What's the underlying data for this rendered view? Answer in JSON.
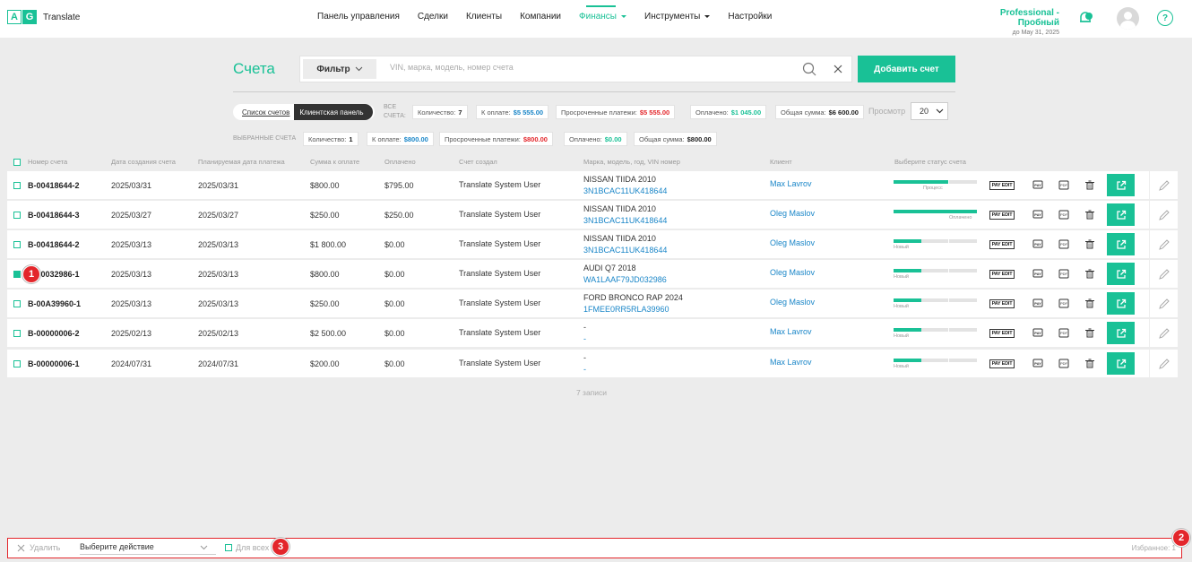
{
  "app": {
    "logo_a": "A",
    "logo_g": "G",
    "name": "Translate"
  },
  "nav": [
    {
      "label": "Панель управления",
      "active": false,
      "dropdown": false
    },
    {
      "label": "Сделки",
      "active": false,
      "dropdown": false
    },
    {
      "label": "Клиенты",
      "active": false,
      "dropdown": false
    },
    {
      "label": "Компании",
      "active": false,
      "dropdown": false
    },
    {
      "label": "Финансы",
      "active": true,
      "dropdown": true
    },
    {
      "label": "Инструменты",
      "active": false,
      "dropdown": true
    },
    {
      "label": "Настройки",
      "active": false,
      "dropdown": false
    }
  ],
  "plan": {
    "name": "Professional - Пробный",
    "until": "до May 31, 2025"
  },
  "help": "?",
  "page": {
    "title": "Счета",
    "filter_label": "Фильтр",
    "search_placeholder": "VIN, марка, модель, номер счета",
    "add_button": "Добавить счет"
  },
  "view_toggle": {
    "list": "Список счетов",
    "panel": "Клиентская панель"
  },
  "all_label_1": "ВСЕ",
  "all_label_2": "СЧЕТА:",
  "all_stats": [
    {
      "label": "Количество:",
      "value": "7",
      "color": "dark"
    },
    {
      "label": "К оплате:",
      "value": "$5 555.00",
      "color": "blue"
    },
    {
      "label": "Просроченные платежи:",
      "value": "$5 555.00",
      "color": "red"
    },
    {
      "label": "Оплачено:",
      "value": "$1 045.00",
      "color": "green"
    },
    {
      "label": "Общая сумма:",
      "value": "$6 600.00",
      "color": "dark"
    }
  ],
  "view_label": "Просмотр",
  "view_count": "20",
  "selected_label": "ВЫБРАННЫЕ СЧЕТА",
  "selected_stats": [
    {
      "label": "Количество:",
      "value": "1",
      "color": "dark"
    },
    {
      "label": "К оплате:",
      "value": "$800.00",
      "color": "blue"
    },
    {
      "label": "Просроченные платежи:",
      "value": "$800.00",
      "color": "red"
    },
    {
      "label": "Оплачено:",
      "value": "$0.00",
      "color": "green"
    },
    {
      "label": "Общая сумма:",
      "value": "$800.00",
      "color": "dark"
    }
  ],
  "columns": [
    "Номер счета",
    "Дата создания счета",
    "Планируемая дата платежа",
    "Сумма к оплате",
    "Оплачено",
    "Счет создал",
    "Марка, модель, год, VIN номер",
    "Клиент",
    "Выберите статус счета"
  ],
  "pay_edit_label": "PAY EDIT",
  "rows": [
    {
      "number": "B-00418644-2",
      "created": "2025/03/31",
      "planned": "2025/03/31",
      "amount": "$800.00",
      "paid": "$795.00",
      "paid_color": "red",
      "creator": "Translate System User",
      "car": "NISSAN TIIDA 2010",
      "vin": "3N1BCAC11UK418644",
      "client": "Max Lavrov",
      "status": "Процесс",
      "progress": 0.67,
      "checked": false
    },
    {
      "number": "B-00418644-3",
      "created": "2025/03/27",
      "planned": "2025/03/27",
      "amount": "$250.00",
      "paid": "$250.00",
      "paid_color": "green",
      "creator": "Translate System User",
      "car": "NISSAN TIIDA 2010",
      "vin": "3N1BCAC11UK418644",
      "client": "Oleg Maslov",
      "status": "Оплачено",
      "progress": 1.0,
      "checked": false
    },
    {
      "number": "B-00418644-2",
      "created": "2025/03/13",
      "planned": "2025/03/13",
      "amount": "$1 800.00",
      "paid": "$0.00",
      "paid_color": "red",
      "creator": "Translate System User",
      "car": "NISSAN TIIDA 2010",
      "vin": "3N1BCAC11UK418644",
      "client": "Oleg Maslov",
      "status": "Новый",
      "progress": 0.33,
      "checked": false
    },
    {
      "number": "B-00032986-1",
      "created": "2025/03/13",
      "planned": "2025/03/13",
      "amount": "$800.00",
      "paid": "$0.00",
      "paid_color": "red",
      "creator": "Translate System User",
      "car": "AUDI Q7 2018",
      "vin": "WA1LAAF79JD032986",
      "client": "Oleg Maslov",
      "status": "Новый",
      "progress": 0.33,
      "checked": true
    },
    {
      "number": "B-00A39960-1",
      "created": "2025/03/13",
      "planned": "2025/03/13",
      "amount": "$250.00",
      "paid": "$0.00",
      "paid_color": "red",
      "creator": "Translate System User",
      "car": "FORD BRONCO RAP 2024",
      "vin": "1FMEE0RR5RLA39960",
      "client": "Oleg Maslov",
      "status": "Новый",
      "progress": 0.33,
      "checked": false
    },
    {
      "number": "B-00000006-2",
      "created": "2025/02/13",
      "planned": "2025/02/13",
      "amount": "$2 500.00",
      "paid": "$0.00",
      "paid_color": "red",
      "creator": "Translate System User",
      "car": "-",
      "vin": "-",
      "client": "Max Lavrov",
      "status": "Новый",
      "progress": 0.33,
      "checked": false
    },
    {
      "number": "B-00000006-1",
      "created": "2024/07/31",
      "planned": "2024/07/31",
      "amount": "$200.00",
      "paid": "$0.00",
      "paid_color": "red",
      "creator": "Translate System User",
      "car": "-",
      "vin": "-",
      "client": "Max Lavrov",
      "status": "Новый",
      "progress": 0.33,
      "checked": false
    }
  ],
  "records": "7 записи",
  "bottom": {
    "delete": "Удалить",
    "action_placeholder": "Выберите действие",
    "for_all": "Для всех",
    "favorites": "Избранное: 1"
  },
  "badges": [
    "1",
    "2",
    "3"
  ],
  "colors": {
    "accent": "#19c196",
    "link": "#1a86c8",
    "danger": "#e3262b"
  }
}
